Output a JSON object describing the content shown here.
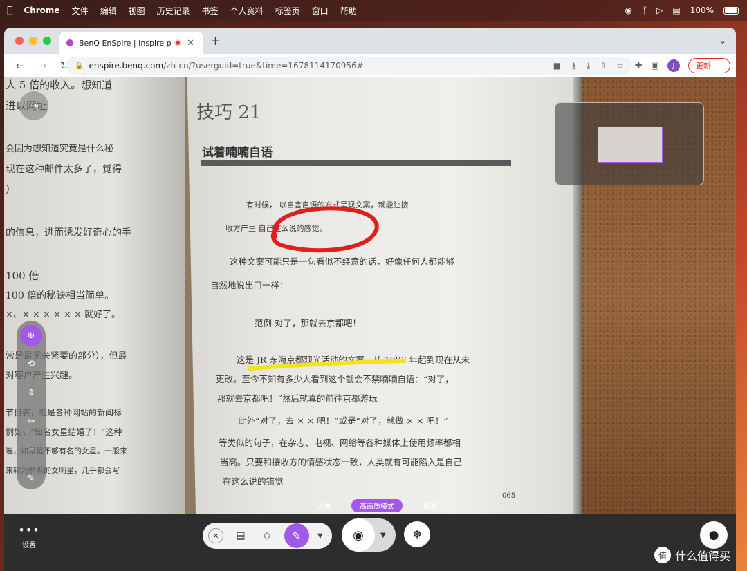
{
  "menubar": {
    "app": "Chrome",
    "items": [
      "文件",
      "编辑",
      "视图",
      "历史记录",
      "书签",
      "个人资料",
      "标签页",
      "窗口",
      "帮助"
    ],
    "battery": "100%"
  },
  "browser": {
    "tab_title": "BenQ EnSpire | Inspire peo",
    "url_host": "enspire.benq.com",
    "url_path": "/zh-cn/?userguid=true&time=1678114170956#",
    "avatar_letter": "J",
    "update_label": "更新"
  },
  "book": {
    "left_lines": [
      "人 5 倍的收入。想知道",
      "进以网址",
      "会因为想知道究竟是什么秘",
      "现在这种邮件太多了，觉得",
      ")",
      "的信息，进而诱发好奇心的手",
      "100 倍",
      "100 倍的秘诀相当简单。",
      "×、× × × × × ×  就好了。",
      "常是最无关紧要的部分），但最",
      "对客户产生兴趣。",
      "节目表，或是各种网站的新闻标",
      "例如，“知名女星结婚了！”这种",
      "遍，如果是不够有名的女星。一般来",
      "来较为熟悉的女明星，几乎都会写"
    ],
    "chapter": "技巧 21",
    "section_title": "试着喃喃自语",
    "lines": [
      "有时候，  以自言自语的方式呈现文案，就能让接",
      "收方产生  自己这么说的感觉。",
      "这种文案可能只是一句看似不经意的话，好像任何人都能够",
      "自然地说出口一样：",
      "范例   对了，那就去京都吧！",
      "这是 JR 东海京都观光活动的文案，从 1993 年起到现在从未",
      "更改。至今不知有多少人看到这个就会不禁喃喃自语：“对了，",
      "那就去京都吧！”然后就真的前往京都游玩。",
      "此外“对了，去 × × 吧！”或是“对了，就做 × × 吧！”",
      "等类似的句子，在杂志、电视、网络等各种媒体上使用频率都相",
      "当高。只要和接收方的情感状态一致，人类就有可能陷入是自己",
      "在这么说的错觉。"
    ],
    "page_number": "065"
  },
  "side_tools": {
    "icons": [
      "zoom-in-icon",
      "rotate-icon",
      "flip-vertical-icon",
      "flip-horizontal-icon",
      "crop-icon",
      "pencil-icon"
    ]
  },
  "modes": {
    "items": [
      "人像",
      "高画质模式",
      "展演"
    ],
    "active": "高画质模式"
  },
  "bottom": {
    "settings_label": "设置"
  },
  "watermark": {
    "badge": "值",
    "text": "什么值得买"
  },
  "colors": {
    "accent": "#a259e8",
    "red_circle": "#e0201c",
    "yellow_underline": "#f5e31a",
    "update_red": "#d93025"
  }
}
